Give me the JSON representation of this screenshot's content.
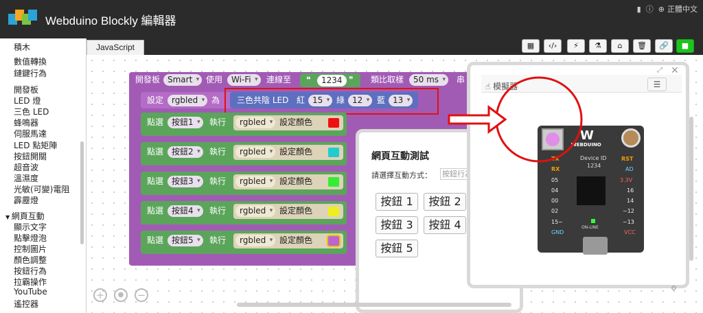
{
  "app": {
    "title": "Webduino Blockly 編輯器"
  },
  "toplinks": {
    "lang": "正體中文"
  },
  "editor": {
    "tab": "JavaScript"
  },
  "sidebar": {
    "items": [
      "積木",
      "數值轉換",
      "鏈鍵行為",
      "開發板",
      "LED 燈",
      "三色 LED",
      "蜂鳴器",
      "伺服馬達",
      "LED 點矩陣",
      "按鈕開關",
      "超音波",
      "溫濕度",
      "光敏(可變)電阻",
      "霹靂燈",
      "網頁互動",
      "顯示文字",
      "點擊燈泡",
      "控制圖片",
      "顏色調整",
      "按鈕行為",
      "拉霸操作",
      "YouTube",
      "遙控器"
    ],
    "expanded_category": "網頁互動"
  },
  "blocks": {
    "board": {
      "label1": "開發板",
      "board_type": "Smart",
      "label2": "使用",
      "conn": "Wi-Fi",
      "label3": "連線至",
      "device_id": "1234",
      "label4": "類比取樣",
      "sample": "50 ms",
      "label5": "串"
    },
    "setvar": {
      "label": "設定",
      "var": "rgbled",
      "label2": "為"
    },
    "rgbled": {
      "label": "三色共陰 LED",
      "red_label": "紅",
      "red": "15",
      "green_label": "綠",
      "green": "12",
      "blue_label": "藍",
      "blue": "13"
    },
    "clicks": [
      {
        "label": "點選",
        "button": "按鈕1",
        "exec": "執行",
        "var": "rgbled",
        "action": "設定顏色",
        "color": "#ee1111"
      },
      {
        "label": "點選",
        "button": "按鈕2",
        "exec": "執行",
        "var": "rgbled",
        "action": "設定顏色",
        "color": "#22cccc"
      },
      {
        "label": "點選",
        "button": "按鈕3",
        "exec": "執行",
        "var": "rgbled",
        "action": "設定顏色",
        "color": "#33ee33"
      },
      {
        "label": "點選",
        "button": "按鈕4",
        "exec": "執行",
        "var": "rgbled",
        "action": "設定顏色",
        "color": "#eeee22"
      },
      {
        "label": "點選",
        "button": "按鈕5",
        "exec": "執行",
        "var": "rgbled",
        "action": "設定顏色",
        "color": "#bb66cc"
      }
    ]
  },
  "web_panel": {
    "title": "網頁互動測試",
    "prompt": "請選擇互動方式：",
    "select_value": "按鈕行為",
    "buttons": [
      "按鈕 1",
      "按鈕 2",
      "按鈕 3",
      "按鈕 4",
      "按鈕 5"
    ]
  },
  "simulator": {
    "title": "模擬器",
    "brand": "WEBDUINO",
    "device_id_label": "Device ID",
    "device_id": "1234",
    "online": "ON-LINE",
    "left_pins": [
      "TX",
      "RX",
      "05",
      "04",
      "00",
      "02",
      "15~",
      "GND"
    ],
    "right_pins": [
      "RST",
      "AD",
      "3.3V",
      "16",
      "14",
      "~12",
      "~13",
      "VCC"
    ]
  },
  "colors": {
    "accent_red": "#e01010",
    "block_purple": "#a25bb5",
    "block_green": "#5ba55b",
    "run_green": "#1fc31f"
  }
}
